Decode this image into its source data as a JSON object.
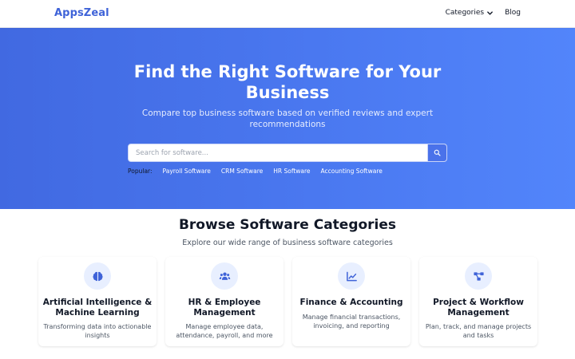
{
  "nav": {
    "logo": "AppsZeal",
    "categories_label": "Categories",
    "blog_label": "Blog"
  },
  "hero": {
    "title_line1": "Find the Right Software for Your",
    "title_line2": "Business",
    "subtitle_line1": "Compare top business software based on verified reviews and expert",
    "subtitle_line2": "recommendations",
    "search_placeholder": "Search for software...",
    "popular_label": "Popular:",
    "popular_links": [
      "Payroll Software",
      "CRM Software",
      "HR Software",
      "Accounting Software"
    ]
  },
  "categories_section": {
    "title": "Browse Software Categories",
    "subtitle": "Explore our wide range of business software categories",
    "cards": [
      {
        "icon": "brain-icon",
        "title_line1": "Artificial Intelligence &",
        "title_line2": "Machine Learning",
        "desc_line1": "Transforming data into actionable",
        "desc_line2": "insights"
      },
      {
        "icon": "users-icon",
        "title_line1": "HR & Employee",
        "title_line2": "Management",
        "desc_line1": "Manage employee data,",
        "desc_line2": "attendance, payroll, and more"
      },
      {
        "icon": "chart-line-icon",
        "title_line1": "Finance & Accounting",
        "title_line2": "",
        "desc_line1": "Manage financial transactions,",
        "desc_line2": "invoicing, and reporting"
      },
      {
        "icon": "project-diagram-icon",
        "title_line1": "Project & Workflow",
        "title_line2": "Management",
        "desc_line1": "Plan, track, and manage projects",
        "desc_line2": "and tasks"
      }
    ]
  },
  "colors": {
    "brand": "#3f63d8",
    "hero_start": "#4169e1",
    "hero_end": "#5285fb",
    "icon_bg": "#e8efff",
    "icon_fg": "#3f63d8"
  }
}
